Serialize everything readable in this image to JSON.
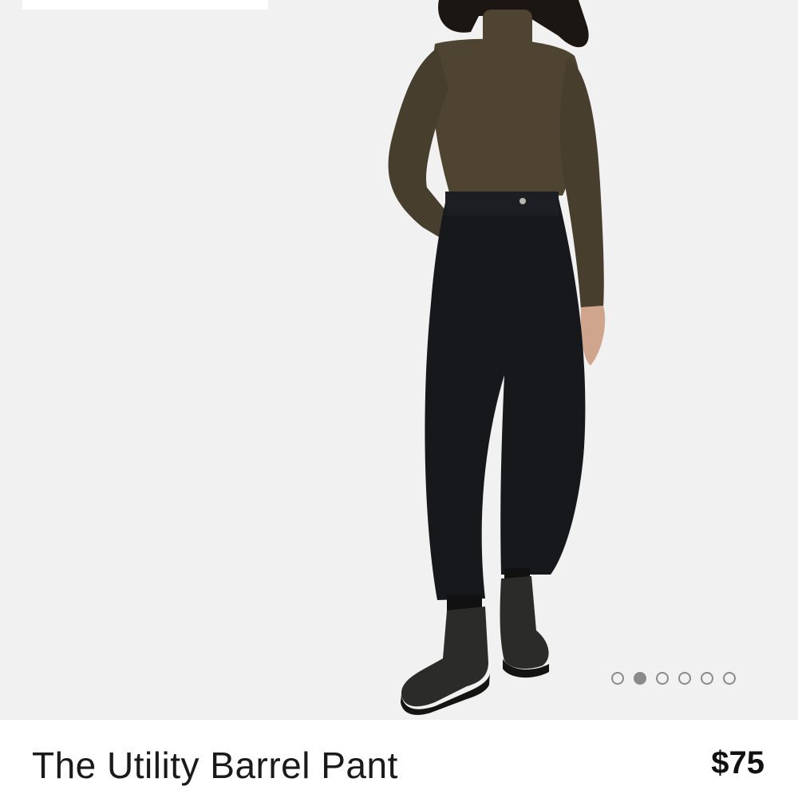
{
  "product": {
    "name": "The Utility Barrel Pant",
    "price": "$75"
  },
  "gallery": {
    "image_count": 6,
    "active_index": 1,
    "dot_color": "#8a8a8a",
    "background": "#f1f1f1"
  },
  "colors": {
    "turtleneck": "#4e4431",
    "pants": "#17181c",
    "boots": "#2b2b29",
    "skin": "#d0a58d",
    "hair": "#1c1612"
  }
}
